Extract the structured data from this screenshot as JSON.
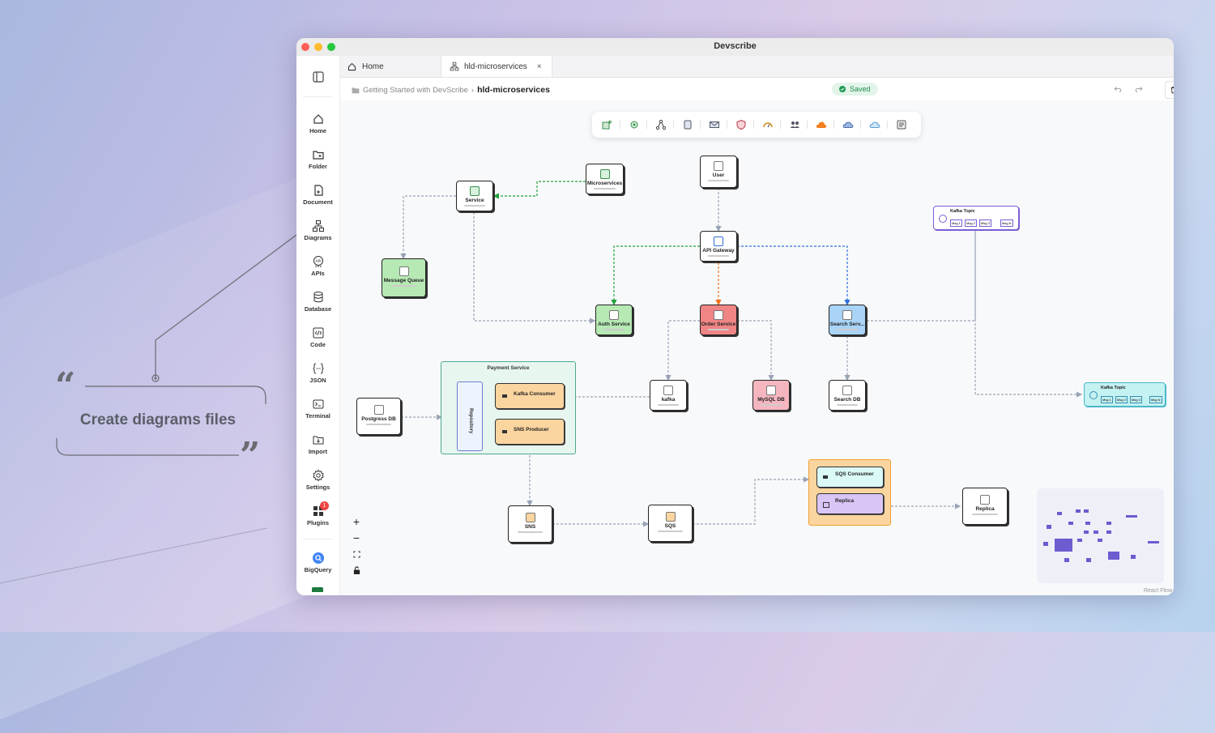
{
  "callout": {
    "text": "Create diagrams files"
  },
  "window": {
    "title": "Devscribe"
  },
  "sidebar": {
    "items": [
      {
        "label": "Home",
        "icon": "home-icon"
      },
      {
        "label": "Folder",
        "icon": "folder-plus-icon"
      },
      {
        "label": "Document",
        "icon": "document-plus-icon"
      },
      {
        "label": "Diagrams",
        "icon": "diagram-icon"
      },
      {
        "label": "APIs",
        "icon": "api-icon"
      },
      {
        "label": "Database",
        "icon": "database-icon"
      },
      {
        "label": "Code",
        "icon": "code-icon"
      },
      {
        "label": "JSON",
        "icon": "json-icon"
      },
      {
        "label": "Terminal",
        "icon": "terminal-icon"
      },
      {
        "label": "Import",
        "icon": "import-icon"
      },
      {
        "label": "Settings",
        "icon": "settings-icon"
      },
      {
        "label": "Plugins",
        "icon": "plugins-icon",
        "badge": "1"
      },
      {
        "label": "BigQuery",
        "icon": "bigquery-icon"
      }
    ]
  },
  "tabs": [
    {
      "label": "Home",
      "icon": "home-icon"
    },
    {
      "label": "hld-microservices",
      "icon": "diagram-icon",
      "close": "×"
    }
  ],
  "breadcrumb": {
    "parent": "Getting Started with DevScribe",
    "separator": "›",
    "current": "hld-microservices"
  },
  "status": {
    "saved": "Saved"
  },
  "nodes": {
    "microservices": "Microservices",
    "user": "User",
    "service": "Service",
    "api_gateway": "API Gateway",
    "kafka_topic_top": "Kafka Topic",
    "message_queue": "Message Queue",
    "auth_service": "Auth Service",
    "order_service": "Order Service",
    "search_service": "Search Serv...",
    "payment_service": "Payment Service",
    "repository": "Repository",
    "kafka_consumer": "Kafka Consumer",
    "sns_producer": "SNS Producer",
    "kafka": "kafka",
    "mysql_db": "MySQL DB",
    "search_db": "Search DB",
    "postgres_db": "Postgress DB",
    "kafka_topic_right": "Kafka Topic",
    "sqs_consumer": "SQS Consumer",
    "replica_inner": "Replica",
    "replica": "Replica",
    "sns": "SNS",
    "sqs": "SQS"
  },
  "kafka_msgs": {
    "m1": "Msg 1",
    "m2": "Msg 2",
    "m3": "Msg 3",
    "mn": "Msg N"
  },
  "zoom": {
    "in": "+",
    "out": "−"
  },
  "footer": {
    "react_flow": "React Flow"
  },
  "colors": {
    "green": "#b6e9b4",
    "red": "#f08585",
    "blue": "#a9d3f7",
    "orange": "#fbd5a0",
    "purple": "#d9c6f6",
    "teal": "#c4f1f2",
    "mint": "#e7f6ef"
  }
}
